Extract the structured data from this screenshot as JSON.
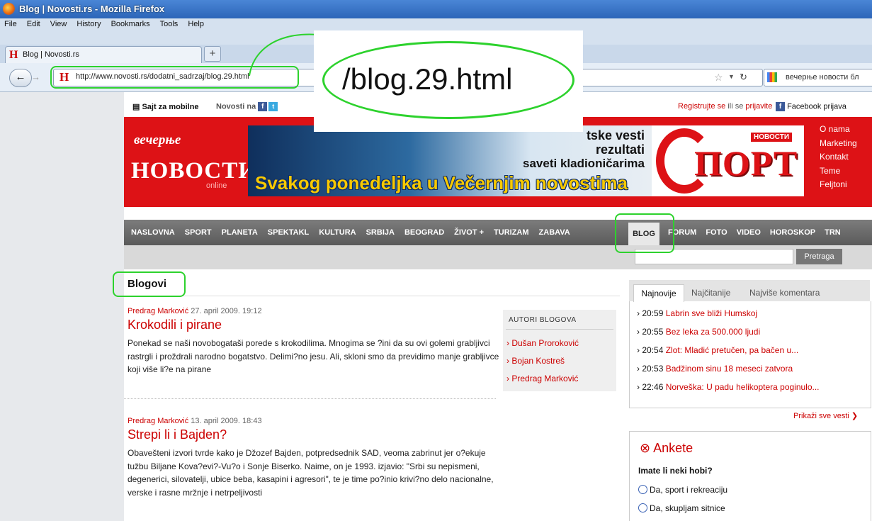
{
  "browser": {
    "title": "Blog | Novosti.rs - Mozilla Firefox",
    "menu": [
      "File",
      "Edit",
      "View",
      "History",
      "Bookmarks",
      "Tools",
      "Help"
    ],
    "tab_label": "Blog | Novosti.rs",
    "new_tab": "+",
    "url": "http://www.novosti.rs/dodatni_sadrzaj/blog.29.html",
    "search_text": "вечерње новости бл"
  },
  "annotation": {
    "callout_text": "/blog.29.html"
  },
  "topbar": {
    "mobile": "Sajt za mobilne",
    "novosti_na": "Novosti na",
    "register": "Registrujte se",
    "or": "ili se",
    "login": "prijavite",
    "facebook": "Facebook prijava"
  },
  "header": {
    "logo_top": "вечерње",
    "logo_main": "НОВОСТИ",
    "logo_sub": "online",
    "banner_line1": "tske vesti",
    "banner_line2": "rezultati",
    "banner_line3": "saveti kladioničarima",
    "banner_main": "Svakog ponedeljka u Večernjim novostima",
    "sport_novosti": "НОВОСТИ",
    "sport_word": "ПОРТ",
    "side_links": [
      "O nama",
      "Marketing",
      "Kontakt",
      "Teme",
      "Feljtoni"
    ]
  },
  "nav": {
    "items": [
      "NASLOVNA",
      "SPORT",
      "PLANETA",
      "SPEKTAKL",
      "KULTURA",
      "SRBIJA",
      "BEOGRAD",
      "ŽIVOT +",
      "TURIZAM",
      "ZABAVA"
    ],
    "active": "BLOG",
    "items2": [
      "FORUM",
      "FOTO",
      "VIDEO",
      "HOROSKOP",
      "TRN"
    ],
    "search_button": "Pretraga"
  },
  "content": {
    "title": "Blogovi",
    "posts": [
      {
        "author": "Predrag Marković",
        "date": "27. april 2009. 19:12",
        "title": "Krokodili i pirane",
        "body": "Ponekad se naši novobogataši porede s krokodilima. Mnogima se ?ini da su ovi golemi grabljivci rastrgli i proždrali narodno bogatstvo. Delimi?no jesu. Ali, skloni smo da previdimo manje grabljivce koji više li?e na pirane"
      },
      {
        "author": "Predrag Marković",
        "date": "13. april 2009. 18:43",
        "title": "Strepi li i Bajden?",
        "body": "Obavešteni izvori tvrde kako je Džozef Bajden, potpredsednik SAD, veoma zabrinut jer o?ekuje tužbu Biljane Kova?evi?-Vu?o i Sonje Biserko. Naime, on je 1993. izjavio: \"Srbi su nepismeni, degenerici, silovatelji, ubice beba, kasapini i agresori\", te je time po?inio krivi?no delo nacionalne, verske i rasne mržnje i netrpeljivosti"
      }
    ],
    "authors_header": "AUTORI BLOGOVA",
    "authors": [
      "Dušan Proroković",
      "Bojan Kostreš",
      "Predrag Marković"
    ]
  },
  "sidebar": {
    "tabs": [
      "Najnovije",
      "Najčitanije",
      "Najviše komentara"
    ],
    "news": [
      {
        "time": "20:59",
        "title": "Labrin sve bliži Humskoj"
      },
      {
        "time": "20:55",
        "title": "Bez leka za 500.000 ljudi"
      },
      {
        "time": "20:54",
        "title": "Zlot: Mladić pretučen, pa bačen u..."
      },
      {
        "time": "20:53",
        "title": "Badžinom sinu 18 meseci zatvora"
      },
      {
        "time": "22:46",
        "title": "Norveška: U padu helikoptera poginulo..."
      }
    ],
    "more": "Prikaži sve vesti",
    "poll_title": "Ankete",
    "poll_question": "Imate li neki hobi?",
    "poll_options": [
      "Da, sport i rekreaciju",
      "Da, skupljam sitnice"
    ]
  }
}
